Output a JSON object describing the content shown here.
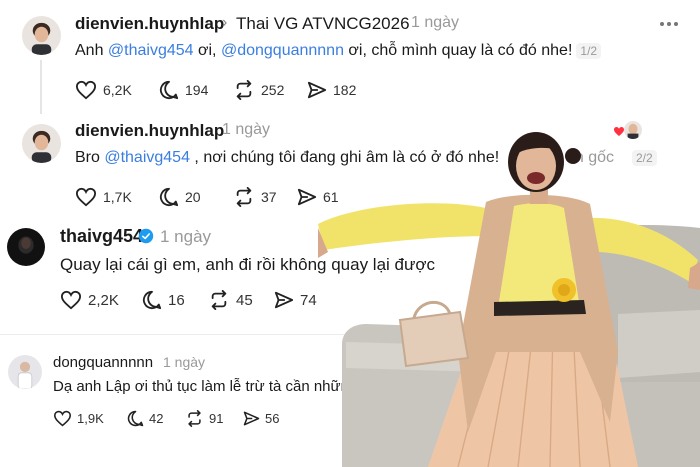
{
  "posts": [
    {
      "username": "dienvien.huynhlap",
      "reply_to": "Thai VG ATVNCG2026",
      "time": "1 ngày",
      "text_prefix": "Anh ",
      "mention1": "@thaivg454",
      "text_mid": " ơi, ",
      "mention2": "@dongquannnnn",
      "text_suffix": " ơi, chỗ mình quay là có đó nhe!",
      "pager": "1/2",
      "likes": "6,2K",
      "comments": "194",
      "reposts": "252",
      "shares": "182"
    },
    {
      "username": "dienvien.huynhlap",
      "time": "1 ngày",
      "text_prefix": "Bro ",
      "mention1": "@thaivg454",
      "text_suffix": " , nơi chúng tôi đang ghi âm là có ở đó nhe!",
      "trailing": "ản gốc",
      "pager": "2/2",
      "likes": "1,7K",
      "comments": "20",
      "reposts": "37",
      "shares": "61"
    },
    {
      "username": "thaivg454",
      "time": "1 ngày",
      "text": "Quay lại cái gì em, anh đi rồi không quay lại được",
      "likes": "2,2K",
      "comments": "16",
      "reposts": "45",
      "shares": "74"
    },
    {
      "username": "dongquannnnn",
      "time": "1 ngày",
      "text": "Dạ anh Lập ơi thủ tục làm lễ trừ tà cần những",
      "likes": "1,9K",
      "comments": "42",
      "reposts": "91",
      "shares": "56"
    }
  ],
  "colors": {
    "mention": "#3a7ee0",
    "verified": "#1d9bf0",
    "liked_heart": "#ff3040"
  },
  "icons": [
    "heart-icon",
    "comment-icon",
    "repost-icon",
    "share-icon",
    "verified-icon",
    "more-icon"
  ]
}
